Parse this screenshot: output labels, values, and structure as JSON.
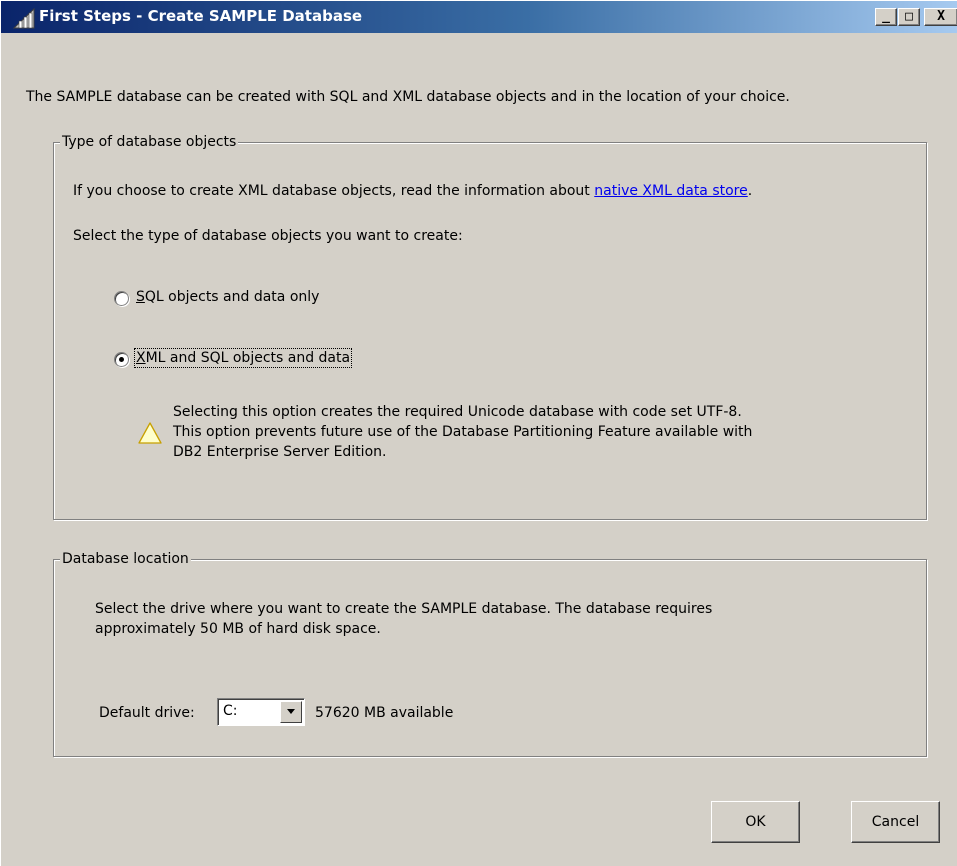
{
  "window": {
    "title": "First Steps - Create SAMPLE Database",
    "minimize_glyph": "_",
    "maximize_glyph": "□",
    "close_glyph": "X",
    "title_gradient": [
      "#0a246a",
      "#a6caf0"
    ]
  },
  "intro": {
    "text": "The SAMPLE database can be created with SQL and XML database objects and in the location of your choice."
  },
  "object_type_group": {
    "legend": "Type of database objects",
    "info_prefix": "If you choose to create XML database objects, read the information about ",
    "info_link": "native XML data store",
    "info_suffix": ".",
    "prompt": "Select the type of database objects you want to create:",
    "options": [
      {
        "mnemonic": "S",
        "label_rest": "QL objects and data only",
        "selected": false
      },
      {
        "mnemonic": "X",
        "label_rest": "ML and SQL objects and data",
        "selected": true
      }
    ],
    "warning": {
      "icon": "warning-icon",
      "lines": [
        "Selecting this option creates the required Unicode database with code set UTF-8.",
        "This option prevents future use of the Database Partitioning Feature available with",
        "DB2 Enterprise Server Edition."
      ]
    }
  },
  "location_group": {
    "legend": "Database location",
    "desc_lines": [
      "Select the drive where you want to create the SAMPLE database. The database requires",
      "approximately 50 MB of hard disk space."
    ],
    "drive_label": "Default drive:",
    "drive_value": "C:",
    "available": "57620  MB available"
  },
  "buttons": {
    "ok": "OK",
    "cancel": "Cancel"
  }
}
